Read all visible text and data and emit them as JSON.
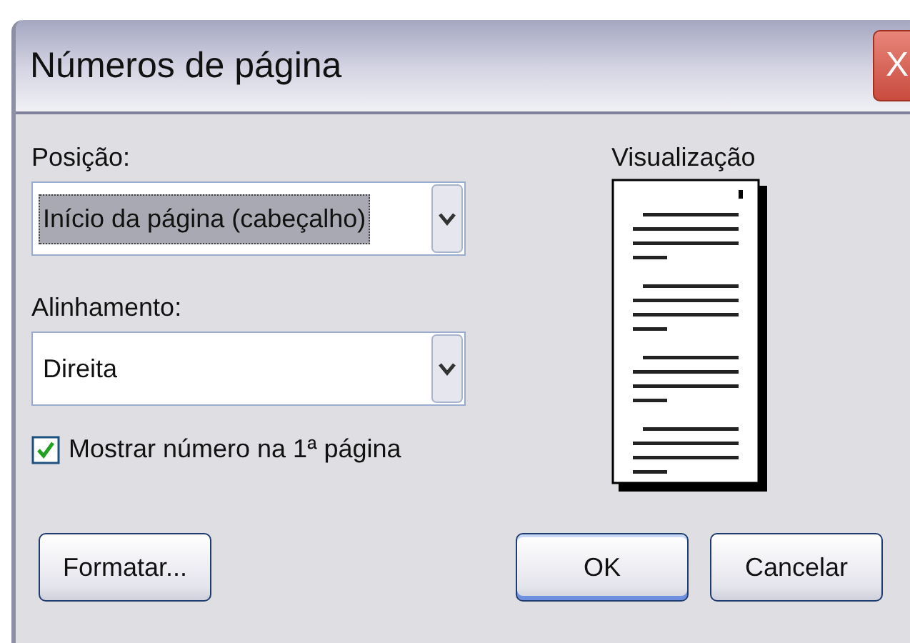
{
  "window": {
    "title": "Números de página",
    "close": "X"
  },
  "fields": [
    {
      "label": "Posição:",
      "value": "Início da página (cabeçalho)",
      "focused": true
    },
    {
      "label": "Alinhamento:",
      "value": "Direita",
      "focused": false
    }
  ],
  "checkbox": {
    "label": "Mostrar número na 1ª página",
    "checked": true
  },
  "preview": {
    "label": "Visualização"
  },
  "buttons": [
    {
      "label": "Formatar...",
      "default": false
    },
    {
      "label": "OK",
      "default": true
    },
    {
      "label": "Cancelar",
      "default": false
    }
  ]
}
